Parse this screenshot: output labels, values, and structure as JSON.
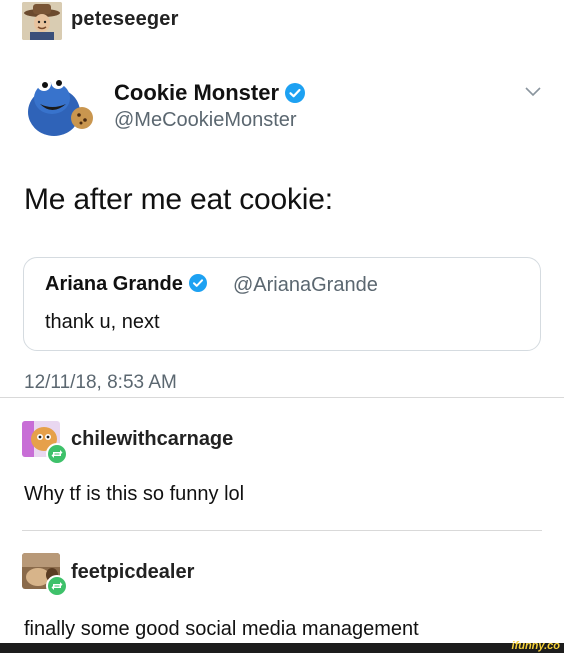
{
  "post": {
    "poster_name": "peteseeger"
  },
  "tweet": {
    "display_name": "Cookie Monster",
    "handle": "@MeCookieMonster",
    "text": "Me after me eat cookie:",
    "timestamp": "12/11/18, 8:53 AM",
    "quoted": {
      "display_name": "Ariana Grande",
      "handle": "@ArianaGrande",
      "text": "thank u, next"
    }
  },
  "reblogs": [
    {
      "name": "chilewithcarnage",
      "text": "Why tf is this so funny lol"
    },
    {
      "name": "feetpicdealer",
      "text": "finally some good social media management"
    }
  ],
  "watermark": "ifunny.co",
  "colors": {
    "verified": "#1da1f2",
    "muted": "#5b6770",
    "reblog_badge": "#3ec16a"
  },
  "icons": [
    "verified-badge-icon",
    "chevron-down-icon",
    "reblog-icon"
  ]
}
